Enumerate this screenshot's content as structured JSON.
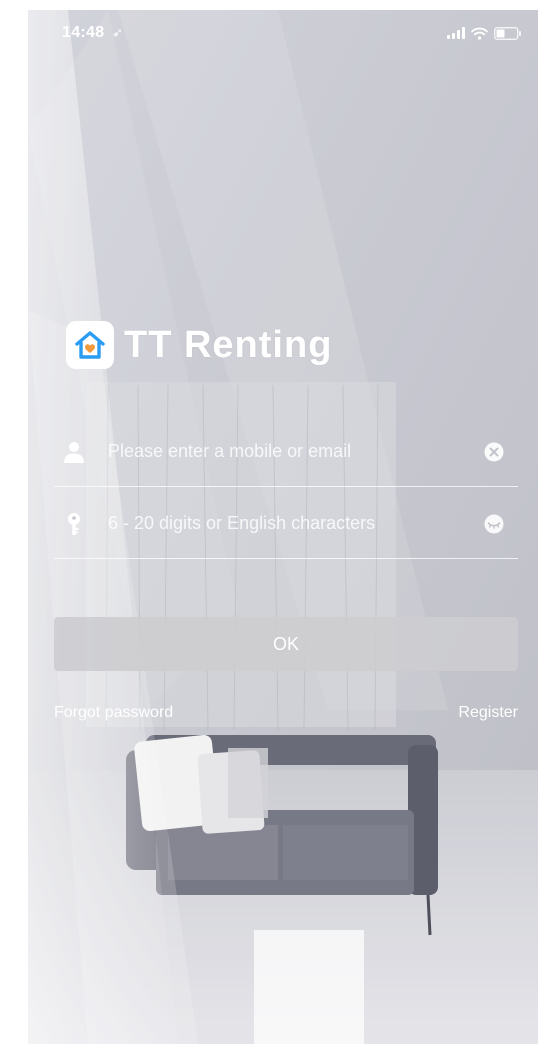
{
  "status_bar": {
    "time": "14:48",
    "location_glyph": "➶",
    "icons": [
      "signal-icon",
      "wifi-icon",
      "battery-icon"
    ]
  },
  "app": {
    "name": "TT Renting",
    "logo_icon": "house-heart-icon",
    "accent_color": "#2a9cf3",
    "heart_color": "#f39a3c"
  },
  "login_form": {
    "account": {
      "placeholder": "Please enter a mobile or email",
      "value": "",
      "leading_icon": "user-icon",
      "trailing_icon": "clear-icon"
    },
    "password": {
      "placeholder": "6 - 20 digits or English characters",
      "value": "",
      "leading_icon": "key-icon",
      "trailing_icon": "eye-closed-icon"
    },
    "ok_label": "OK",
    "forgot_label": "Forgot password",
    "register_label": "Register"
  }
}
